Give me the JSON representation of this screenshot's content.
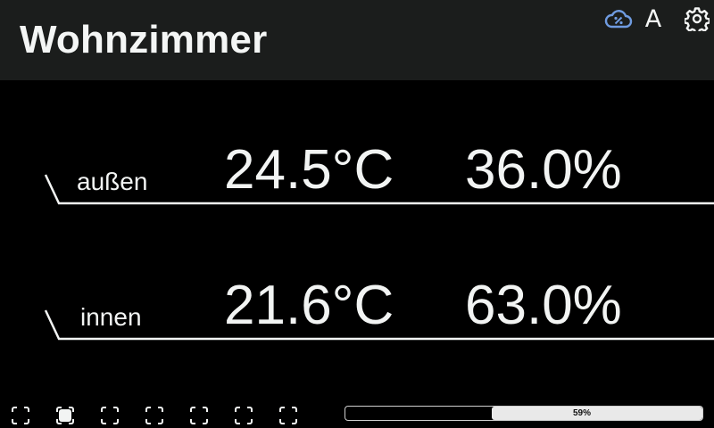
{
  "header": {
    "title": "Wohnzimmer",
    "icons": {
      "cloud": "cloud-sync-icon",
      "font": "A",
      "settings": "gear-icon"
    },
    "accent_color": "#6f9be0"
  },
  "sensors": [
    {
      "label": "außen",
      "temperature": "24.5°C",
      "humidity": "36.0%"
    },
    {
      "label": "innen",
      "temperature": "21.6°C",
      "humidity": "63.0%"
    }
  ],
  "footer": {
    "page_count": 7,
    "active_page": 2,
    "progress_label": "59%",
    "progress_value": 0.59
  }
}
